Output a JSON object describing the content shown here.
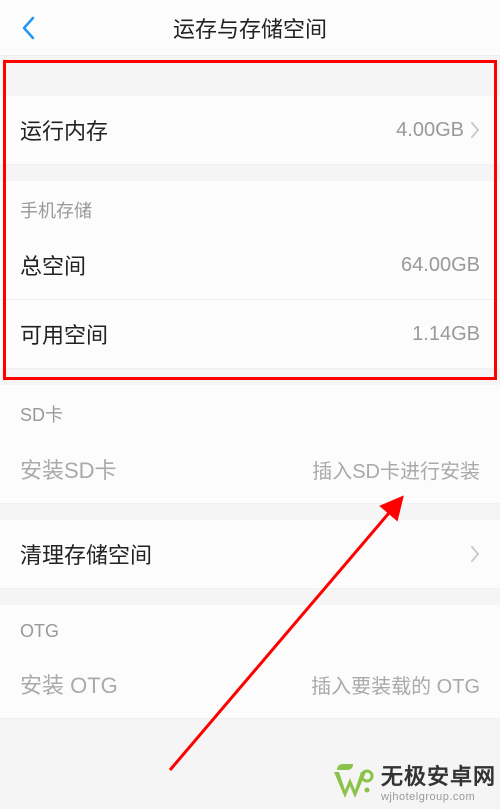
{
  "header": {
    "title": "运存与存储空间"
  },
  "ram": {
    "label": "运行内存",
    "value": "4.00GB"
  },
  "phoneStorage": {
    "header": "手机存储",
    "total": {
      "label": "总空间",
      "value": "64.00GB"
    },
    "available": {
      "label": "可用空间",
      "value": "1.14GB"
    }
  },
  "sd": {
    "header": "SD卡",
    "install": {
      "label": "安装SD卡",
      "hint": "插入SD卡进行安装"
    }
  },
  "cleanup": {
    "label": "清理存储空间"
  },
  "otg": {
    "header": "OTG",
    "install": {
      "label": "安装 OTG",
      "hint": "插入要装载的 OTG"
    }
  },
  "watermark": {
    "main": "无极安卓网",
    "url": "wjhotelgroup.com"
  }
}
